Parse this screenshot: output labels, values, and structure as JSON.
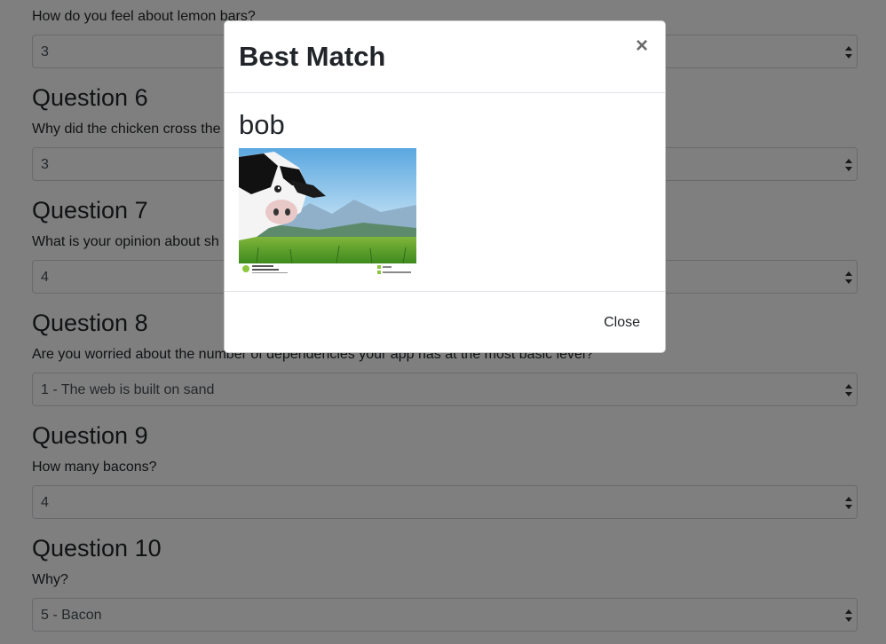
{
  "questions": [
    {
      "prompt": "How do you feel about lemon bars?",
      "selected": "3"
    },
    {
      "heading": "Question 6",
      "prompt": "Why did the chicken cross the",
      "selected": "3"
    },
    {
      "heading": "Question 7",
      "prompt": "What is your opinion about sh",
      "selected": "4"
    },
    {
      "heading": "Question 8",
      "prompt": "Are you worried about the number of dependencies your app has at the most basic level?",
      "selected": "1 - The web is built on sand"
    },
    {
      "heading": "Question 9",
      "prompt": "How many bacons?",
      "selected": "4"
    },
    {
      "heading": "Question 10",
      "prompt": "Why?",
      "selected": "5 - Bacon"
    }
  ],
  "modal": {
    "title": "Best Match",
    "close_symbol": "×",
    "match_name": "bob",
    "photo_icon": "cow-photo",
    "close_button_label": "Close"
  },
  "colors": {
    "overlay": "#000000",
    "border": "#ced4da",
    "text": "#212529"
  }
}
